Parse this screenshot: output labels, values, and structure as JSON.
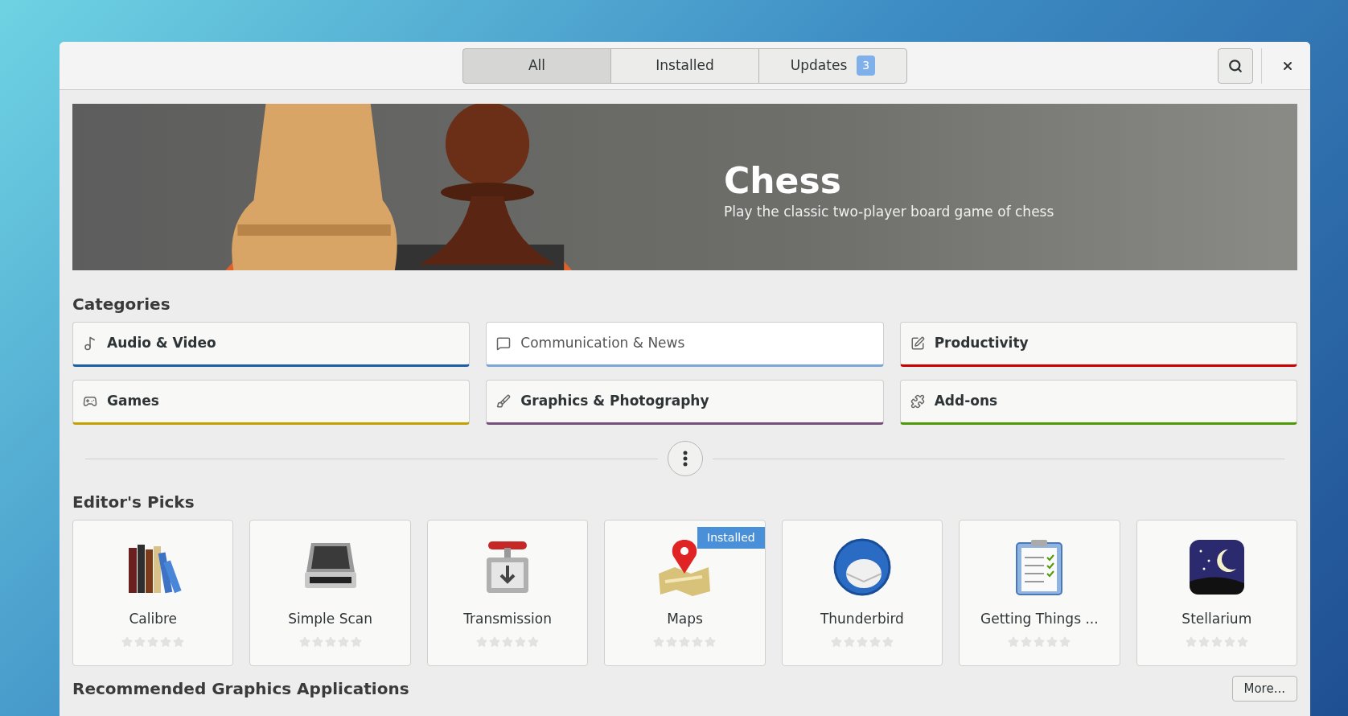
{
  "header": {
    "tabs": [
      {
        "label": "All",
        "selected": true
      },
      {
        "label": "Installed",
        "selected": false
      },
      {
        "label": "Updates",
        "selected": false,
        "count": "3"
      }
    ]
  },
  "banner": {
    "kind": "picture",
    "title": "Chess",
    "description": "Play the classic two-player board game of chess"
  },
  "categories": {
    "title": "Categories",
    "items": [
      {
        "label": "Audio & Video",
        "color": "#1c5fa8",
        "selected": false
      },
      {
        "label": "Communication & News",
        "color": "#7aa7d6",
        "selected": true
      },
      {
        "label": "Productivity",
        "color": "#cc0000",
        "selected": false
      },
      {
        "label": "Games",
        "color": "#c4a000",
        "selected": false
      },
      {
        "label": "Graphics & Photography",
        "color": "#75507b",
        "selected": false
      },
      {
        "label": "Add-ons",
        "color": "#4e9a06",
        "selected": false
      }
    ]
  },
  "editors_picks": {
    "title": "Editor's Picks",
    "apps": [
      {
        "name": "Calibre",
        "installed": false,
        "stars": 0
      },
      {
        "name": "Simple Scan",
        "installed": false,
        "stars": 0
      },
      {
        "name": "Transmission",
        "installed": false,
        "stars": 0
      },
      {
        "name": "Maps",
        "installed": true,
        "badge": "Installed",
        "stars": 0
      },
      {
        "name": "Thunderbird",
        "installed": false,
        "stars": 0
      },
      {
        "name": "Getting Things ...",
        "installed": false,
        "stars": 0
      },
      {
        "name": "Stellarium",
        "installed": false,
        "stars": 0
      }
    ]
  },
  "recommended": {
    "title": "Recommended Graphics Applications",
    "more_button": "More..."
  }
}
